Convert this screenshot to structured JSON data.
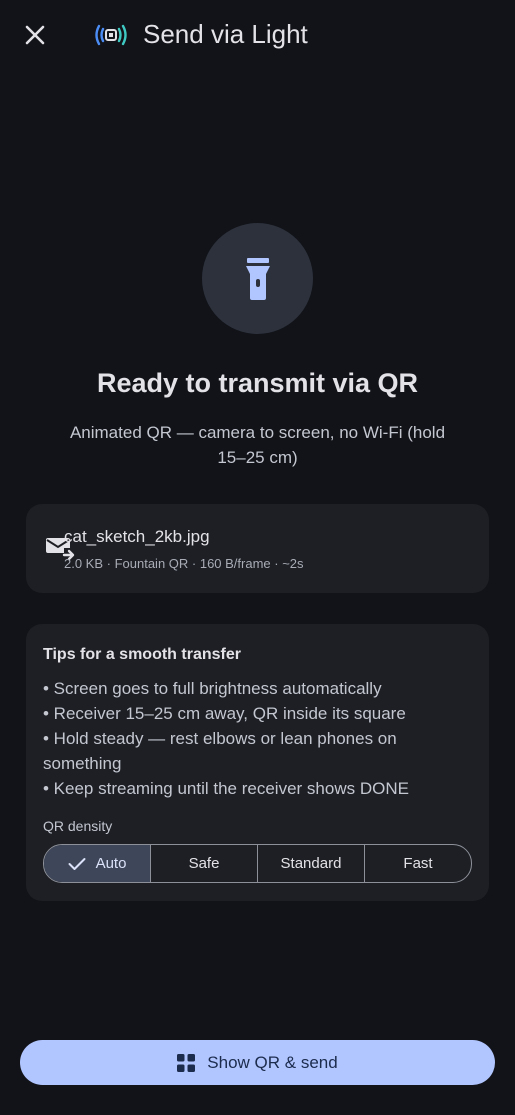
{
  "header": {
    "title": "Send via Light",
    "close_icon": "close-icon",
    "app_icon": "light-broadcast-icon"
  },
  "hero": {
    "icon": "flashlight-icon",
    "headline": "Ready to transmit via QR",
    "subline": "Animated QR — camera to screen, no Wi-Fi (hold 15–25 cm)"
  },
  "file": {
    "icon": "mail-forward-icon",
    "name": "cat_sketch_2kb.jpg",
    "meta": "2.0 KB · Fountain QR · 160 B/frame · ~2s"
  },
  "tips": {
    "title": "Tips for a smooth transfer",
    "items": [
      "• Screen goes to full brightness automatically",
      "• Receiver 15–25 cm away, QR inside its square",
      "• Hold steady — rest elbows or lean phones on something",
      "• Keep streaming until the receiver shows DONE"
    ],
    "density_label": "QR density",
    "density_options": [
      "Auto",
      "Safe",
      "Standard",
      "Fast"
    ],
    "density_selected": "Auto"
  },
  "action": {
    "icon": "grid-icon",
    "label": "Show QR & send"
  },
  "colors": {
    "background": "#111318",
    "card": "#1d1f25",
    "accent": "#b1c5ff",
    "selected_segment": "#3e4759",
    "icon_accent": "#b1c5ff"
  }
}
